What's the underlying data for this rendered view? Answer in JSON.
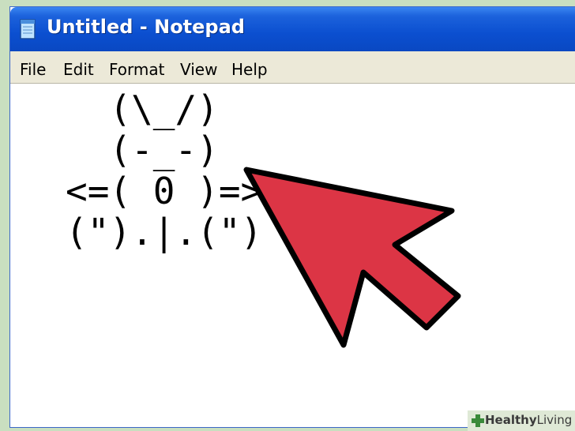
{
  "window": {
    "title": "Untitled - Notepad",
    "title_bar_color": "#0b4fd0"
  },
  "menu": {
    "items": [
      "File",
      "Edit",
      "Format",
      "View",
      "Help"
    ]
  },
  "editor": {
    "lines": [
      "  (\\_/)",
      "  (-_-)",
      "<=( 0 )=>",
      "(\").|.(\")"
    ]
  },
  "arrow": {
    "color": "#dc3545",
    "icon": "cursor-arrow"
  },
  "watermark": {
    "brand_part1": "Healthy",
    "brand_part2": "Living",
    "icon": "plus-icon"
  }
}
